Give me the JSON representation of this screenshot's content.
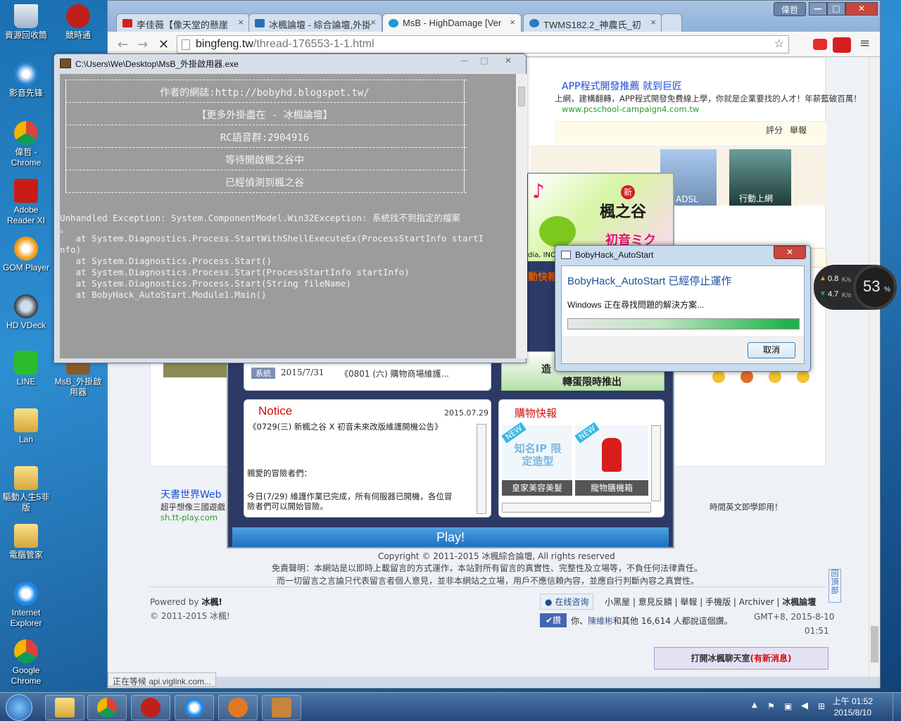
{
  "desktop": {
    "icons": [
      {
        "label": "資源回收筒"
      },
      {
        "label": "競時通"
      },
      {
        "label": "影音先锋"
      },
      {
        "label": "偉哲 - Chrome"
      },
      {
        "label": "Adobe Reader XI"
      },
      {
        "label": "GOM Player"
      },
      {
        "label": "HD VDeck"
      },
      {
        "label": "LINE"
      },
      {
        "label": "MsB_外掛啟用器"
      },
      {
        "label": "Lan"
      },
      {
        "label": "驅動人生5非版"
      },
      {
        "label": "電腦管家"
      },
      {
        "label": "Internet Explorer"
      },
      {
        "label": "Google Chrome"
      }
    ]
  },
  "browser": {
    "user": "偉哲",
    "tabs": [
      {
        "title": "李佳薇【像天堂的懸崖",
        "color": "#d32020"
      },
      {
        "title": "冰楓論壇 - 綜合論壇,外掛",
        "color": "#2a6fb8"
      },
      {
        "title": "MsB - HighDamage [Ver",
        "color": "#1a9ad6"
      },
      {
        "title": "TWMS182.2_神農氏_初",
        "color": "#2a78c8"
      }
    ],
    "url_host": "bingfeng.tw",
    "url_path": "/thread-176553-1-1.html",
    "status": "正在等候 api.viglink.com..."
  },
  "page": {
    "ad_title": "APP程式開發推薦 就到巨匠",
    "ad_desc": "上網，建構翻轉，APP程式開發免費線上學，你就是企業要找的人才！年薪藍破百萬！",
    "ad_url": "www.pcschool-campaign4.com.tw",
    "rate": "評分",
    "report": "舉報",
    "thumb1": "ADSL",
    "thumb2": "行動上網",
    "left_ad_title": "天書世界Web",
    "left_ad_desc": "超乎想像三國遊戲",
    "left_ad_url": "sh.tt-play.com",
    "right_ad_desc": "時間英文即學即用！",
    "copyright": "Copyright © 2011-2015 冰楓綜合論壇, All rights reserved",
    "disclaimer1": "免責聲明：本網站是以即時上載留言的方式運作，本站對所有留言的真實性、完整性及立場等，不負任何法律責任。",
    "disclaimer2": "而一切留言之言論只代表留言者個人意見，並非本網站之立場，用戶不應信賴內容，並應自行判斷內容之真實性。",
    "powered_prefix": "Powered by",
    "powered_by": "冰楓!",
    "footer_copy": "© 2011-2015 冰楓!",
    "online_help": "在线咨询",
    "footer_links": [
      "小黑屋",
      "意見反饋",
      "舉報",
      "手機版",
      "Archiver",
      "冰楓論壇"
    ],
    "like_btn": "讚",
    "like_text_pre": "你、",
    "like_user": "陳維彬",
    "like_text_post": "和其他 16,614 人都說這個讚。",
    "gmt": "GMT+8, 2015-8-10",
    "gmt_time": "01:51",
    "chat": "打開冰楓聊天室",
    "chat_new": "(有新消息)",
    "back_top": "回頂部"
  },
  "launcher": {
    "news_tag": "系統",
    "news_date": "2015/7/31",
    "news_text": "《0801 (六) 購物商場維護...",
    "notice_title": "Notice",
    "notice_date": "2015.07.29",
    "notice_head": "《0729(三) 新楓之谷 X 初音未來改版維護開機公告》",
    "notice_p1": "親愛的冒險者們：",
    "notice_p2": "今日(7/29) 維護作業已完成，所有伺服器已開機，各位冒險者們可以開始冒險。",
    "shop_title": "購物快報",
    "shop_item1_tag": "知名IP 限定造型",
    "shop_item1": "皇家美容美髮",
    "shop_item2": "寵物膳機箱",
    "shop_new": "NEW",
    "promo": "轉蛋限時推出",
    "promo_side": "造",
    "play": "Play!",
    "logo_new": "新",
    "logo": "楓之谷",
    "collab": "初音ミク",
    "side_txt1": "dia, INC",
    "side_txt2": "動快報"
  },
  "console": {
    "title": "C:\\Users\\We\\Desktop\\MsB_外掛啟用器.exe",
    "box_lines": [
      "作者的網誌:http://bobyhd.blogspot.tw/",
      "【更多外掛盡在 - 冰楓論壇】",
      "RC語音群:2904916",
      "等待開啟楓之谷中",
      "已經偵測到楓之谷"
    ],
    "trace": [
      "Unhandled Exception: System.ComponentModel.Win32Exception: 系統找不到指定的檔案",
      "。",
      "   at System.Diagnostics.Process.StartWithShellExecuteEx(ProcessStartInfo startI",
      "nfo)",
      "   at System.Diagnostics.Process.Start()",
      "   at System.Diagnostics.Process.Start(ProcessStartInfo startInfo)",
      "   at System.Diagnostics.Process.Start(String fileName)",
      "   at BobyHack_AutoStart.Module1.Main()"
    ]
  },
  "dialog": {
    "title": "BobyHack_AutoStart",
    "heading": "BobyHack_AutoStart 已經停止運作",
    "message": "Windows 正在尋找問題的解決方案...",
    "cancel": "取消",
    "progress": 1.0
  },
  "net_widget": {
    "up": "0.8",
    "down": "4.7",
    "unit": "K/s",
    "percent": "53",
    "percent_sign": "%"
  },
  "taskbar": {
    "time": "上午 01:52",
    "date": "2015/8/10"
  }
}
